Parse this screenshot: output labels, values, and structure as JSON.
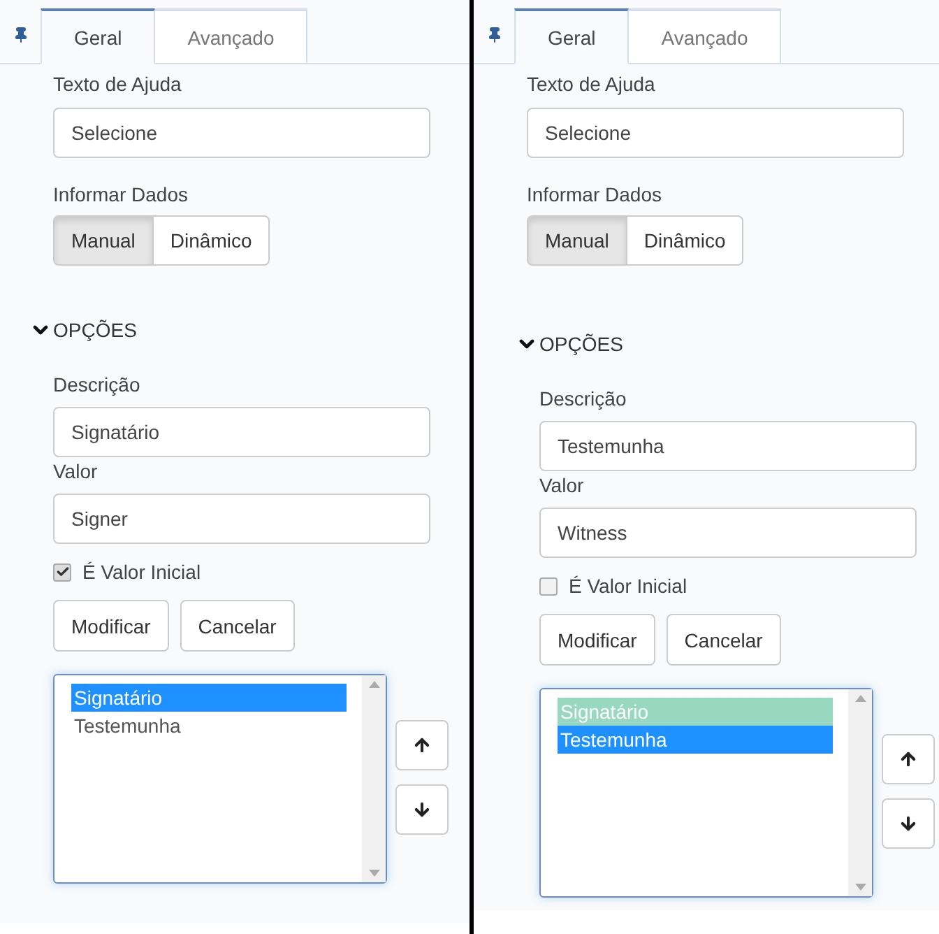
{
  "panels": [
    {
      "tabs": [
        {
          "label": "Geral",
          "selected": true
        },
        {
          "label": "Avançado",
          "selected": false
        }
      ],
      "help_text": {
        "label": "Texto de Ajuda",
        "value": "Selecione"
      },
      "data_source": {
        "label": "Informar Dados",
        "options": [
          {
            "label": "Manual",
            "selected": true
          },
          {
            "label": "Dinâmico",
            "selected": false
          }
        ]
      },
      "options_section": {
        "title": "OPÇÕES",
        "expanded": true,
        "description": {
          "label": "Descrição",
          "value": "Signatário"
        },
        "value": {
          "label": "Valor",
          "value": "Signer"
        },
        "initial_value": {
          "label": "É Valor Inicial",
          "checked": true
        },
        "buttons": [
          "Modificar",
          "Cancelar"
        ],
        "list": [
          {
            "label": "Signatário",
            "selected": true,
            "highlighted": false
          },
          {
            "label": "Testemunha",
            "selected": false,
            "highlighted": false
          }
        ]
      }
    },
    {
      "tabs": [
        {
          "label": "Geral",
          "selected": true
        },
        {
          "label": "Avançado",
          "selected": false
        }
      ],
      "help_text": {
        "label": "Texto de Ajuda",
        "value": "Selecione"
      },
      "data_source": {
        "label": "Informar Dados",
        "options": [
          {
            "label": "Manual",
            "selected": true
          },
          {
            "label": "Dinâmico",
            "selected": false
          }
        ]
      },
      "options_section": {
        "title": "OPÇÕES",
        "expanded": true,
        "description": {
          "label": "Descrição",
          "value": "Testemunha"
        },
        "value": {
          "label": "Valor",
          "value": "Witness"
        },
        "initial_value": {
          "label": "É Valor Inicial",
          "checked": false
        },
        "buttons": [
          "Modificar",
          "Cancelar"
        ],
        "list": [
          {
            "label": "Signatário",
            "selected": false,
            "highlighted": true
          },
          {
            "label": "Testemunha",
            "selected": true,
            "highlighted": false
          }
        ]
      }
    }
  ]
}
